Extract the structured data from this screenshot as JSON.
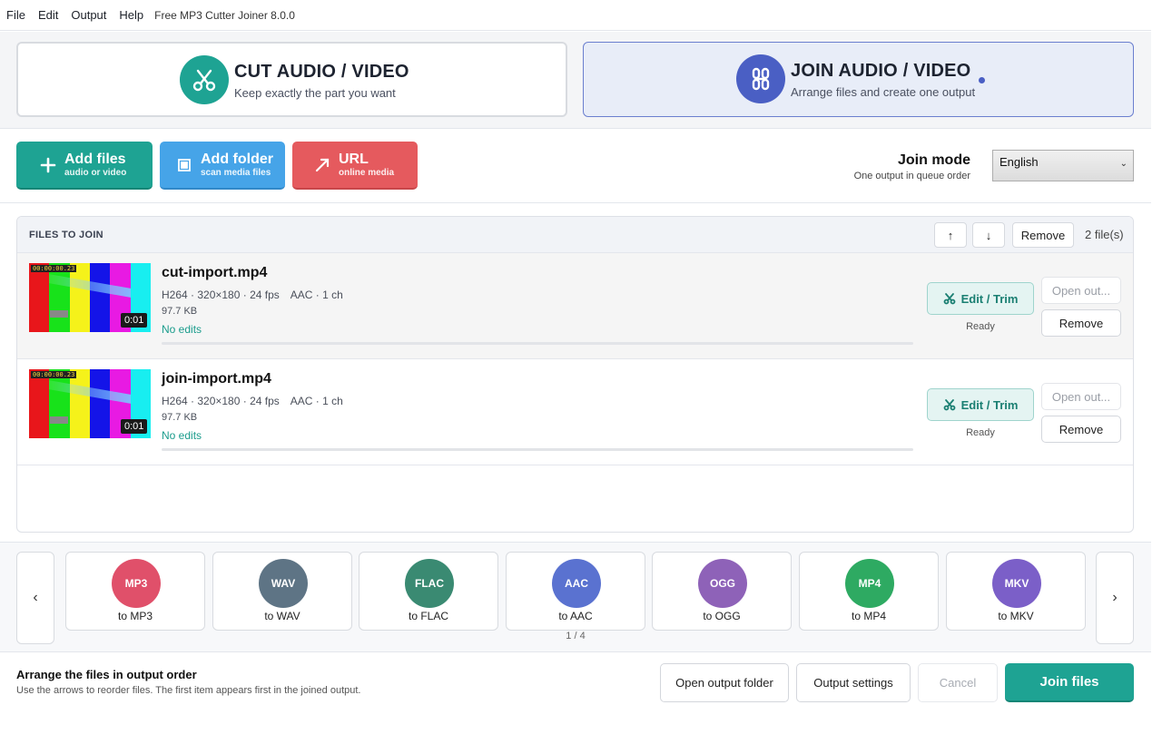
{
  "menubar": {
    "items": [
      "File",
      "Edit",
      "Output",
      "Help"
    ],
    "app_title": "Free MP3 Cutter Joiner 8.0.0"
  },
  "modes": {
    "cut": {
      "title": "CUT AUDIO / VIDEO",
      "subtitle": "Keep exactly the part you want",
      "icon": "scissors-icon"
    },
    "join": {
      "title": "JOIN AUDIO / VIDEO",
      "subtitle": "Arrange files and create one output",
      "icon": "chain-link-icon",
      "selected": true
    }
  },
  "toolbar": {
    "add_files": {
      "label": "Add files",
      "sub": "audio or video",
      "icon": "plus-icon"
    },
    "add_folder": {
      "label": "Add folder",
      "sub": "scan media files",
      "icon": "folder-icon"
    },
    "url": {
      "label": "URL",
      "sub": "online media",
      "icon": "arrow-up-right-icon"
    },
    "join_mode": {
      "title": "Join mode",
      "subtitle": "One output in queue order"
    },
    "language": "English"
  },
  "filelist": {
    "title": "FILES TO JOIN",
    "up_label": "↑",
    "down_label": "↓",
    "remove_label": "Remove",
    "count": "2 file(s)",
    "files": [
      {
        "name": "cut-import.mp4",
        "video": "H264 · 320×180 · 24 fps",
        "audio": "AAC · 1 ch",
        "size": "97.7 KB",
        "edits": "No edits",
        "duration": "0:01",
        "thumb_timecode": "00:00:00.23",
        "edit_label": "Edit / Trim",
        "status": "Ready",
        "open_label": "Open out...",
        "remove_label": "Remove"
      },
      {
        "name": "join-import.mp4",
        "video": "H264 · 320×180 · 24 fps",
        "audio": "AAC · 1 ch",
        "size": "97.7 KB",
        "edits": "No edits",
        "duration": "0:01",
        "thumb_timecode": "00:00:00.23",
        "edit_label": "Edit / Trim",
        "status": "Ready",
        "open_label": "Open out...",
        "remove_label": "Remove"
      }
    ]
  },
  "presets": {
    "prev_label": "‹",
    "next_label": "›",
    "page": "1 / 4",
    "items": [
      {
        "badge": "MP3",
        "label": "to MP3",
        "color": "#e0506a"
      },
      {
        "badge": "WAV",
        "label": "to WAV",
        "color": "#5e7485"
      },
      {
        "badge": "FLAC",
        "label": "to FLAC",
        "color": "#3a8a72"
      },
      {
        "badge": "AAC",
        "label": "to AAC",
        "color": "#5a72d0"
      },
      {
        "badge": "OGG",
        "label": "to OGG",
        "color": "#8e62b8"
      },
      {
        "badge": "MP4",
        "label": "to MP4",
        "color": "#2eaa62"
      },
      {
        "badge": "MKV",
        "label": "to MKV",
        "color": "#7b5fc8"
      }
    ]
  },
  "footer": {
    "title": "Arrange the files in output order",
    "subtitle": "Use the arrows to reorder files. The first item appears first in the joined output.",
    "open_output": "Open output folder",
    "settings": "Output settings",
    "cancel": "Cancel",
    "join": "Join files"
  },
  "colors": {
    "accent": "#1ea393",
    "join_accent": "#4a5fc4",
    "folder_blue": "#46a4e8",
    "url_red": "#e55a5e"
  }
}
